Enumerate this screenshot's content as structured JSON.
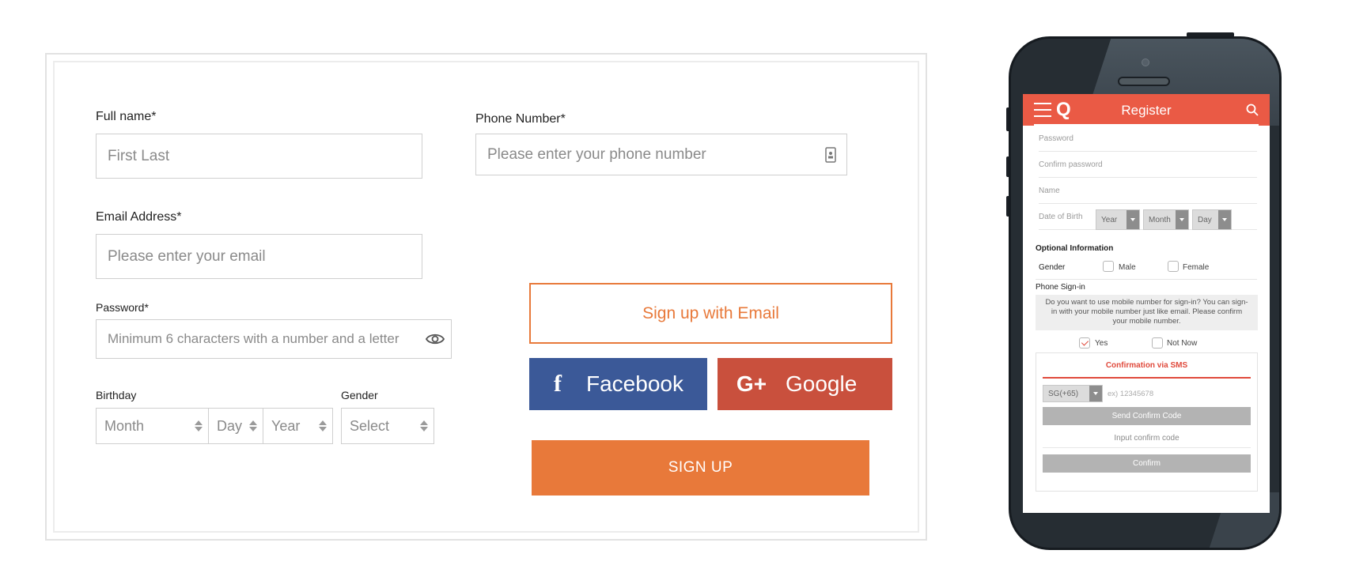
{
  "form": {
    "full_name": {
      "label": "Full name*",
      "placeholder": "First Last"
    },
    "phone": {
      "label": "Phone Number*",
      "placeholder": "Please enter your phone number",
      "icon": "contact-card-icon"
    },
    "email": {
      "label": "Email Address*",
      "placeholder": "Please enter your email"
    },
    "password": {
      "label": "Password*",
      "placeholder": "Minimum 6 characters with a number and a letter",
      "icon": "eye-icon"
    },
    "birthday": {
      "label": "Birthday",
      "month": "Month",
      "day": "Day",
      "year": "Year"
    },
    "gender": {
      "label": "Gender",
      "value": "Select"
    },
    "buttons": {
      "email": "Sign up with Email",
      "facebook": "Facebook",
      "facebook_icon": "f",
      "google": "Google",
      "google_icon": "G+",
      "signup": "SIGN UP"
    },
    "colors": {
      "accent": "#e8793a",
      "facebook": "#3b5998",
      "google": "#c9503d"
    }
  },
  "mobile": {
    "header": {
      "logo": "Q",
      "title": "Register",
      "color": "#ea5a45"
    },
    "fields": {
      "password": "Password",
      "confirm_password": "Confirm password",
      "name": "Name",
      "dob_label": "Date of Birth",
      "year": "Year",
      "month": "Month",
      "day": "Day"
    },
    "optional": {
      "title": "Optional Information",
      "gender_label": "Gender",
      "male": "Male",
      "female": "Female"
    },
    "phone_signin": {
      "title": "Phone Sign-in",
      "info": "Do you want to use mobile number for sign-in?  You can sign-in with your mobile number just like email. Please confirm your mobile number.",
      "yes": "Yes",
      "not_now": "Not Now"
    },
    "sms": {
      "title": "Confirmation via SMS",
      "country_code": "SG(+65)",
      "phone_placeholder": "ex) 12345678",
      "send_button": "Send Confirm Code",
      "code_placeholder": "Input confirm code",
      "confirm_button": "Confirm"
    }
  }
}
